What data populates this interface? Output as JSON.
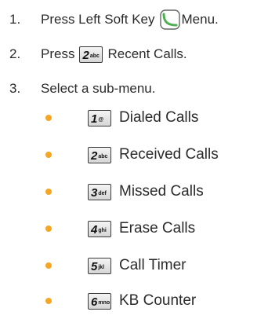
{
  "steps": [
    {
      "num": "1.",
      "before": "Press Left Soft Key",
      "after": "Menu."
    },
    {
      "num": "2.",
      "before": "Press",
      "key": {
        "digit": "2",
        "letters": "abc"
      },
      "after": "Recent Calls."
    },
    {
      "num": "3.",
      "text": "Select a sub-menu."
    }
  ],
  "submenu": [
    {
      "digit": "1",
      "letters": "@",
      "label": "Dialed Calls"
    },
    {
      "digit": "2",
      "letters": "abc",
      "label": "Received Calls"
    },
    {
      "digit": "3",
      "letters": "def",
      "label": "Missed Calls"
    },
    {
      "digit": "4",
      "letters": "ghi",
      "label": "Erase Calls"
    },
    {
      "digit": "5",
      "letters": "jkl",
      "label": "Call Timer"
    },
    {
      "digit": "6",
      "letters": "mno",
      "label": "KB Counter"
    }
  ],
  "colors": {
    "bullet": "#f5a623",
    "softkey_icon": "#4caf50",
    "text": "#2b2b2b"
  },
  "icons": {
    "softkey": "left-soft-key-icon"
  }
}
